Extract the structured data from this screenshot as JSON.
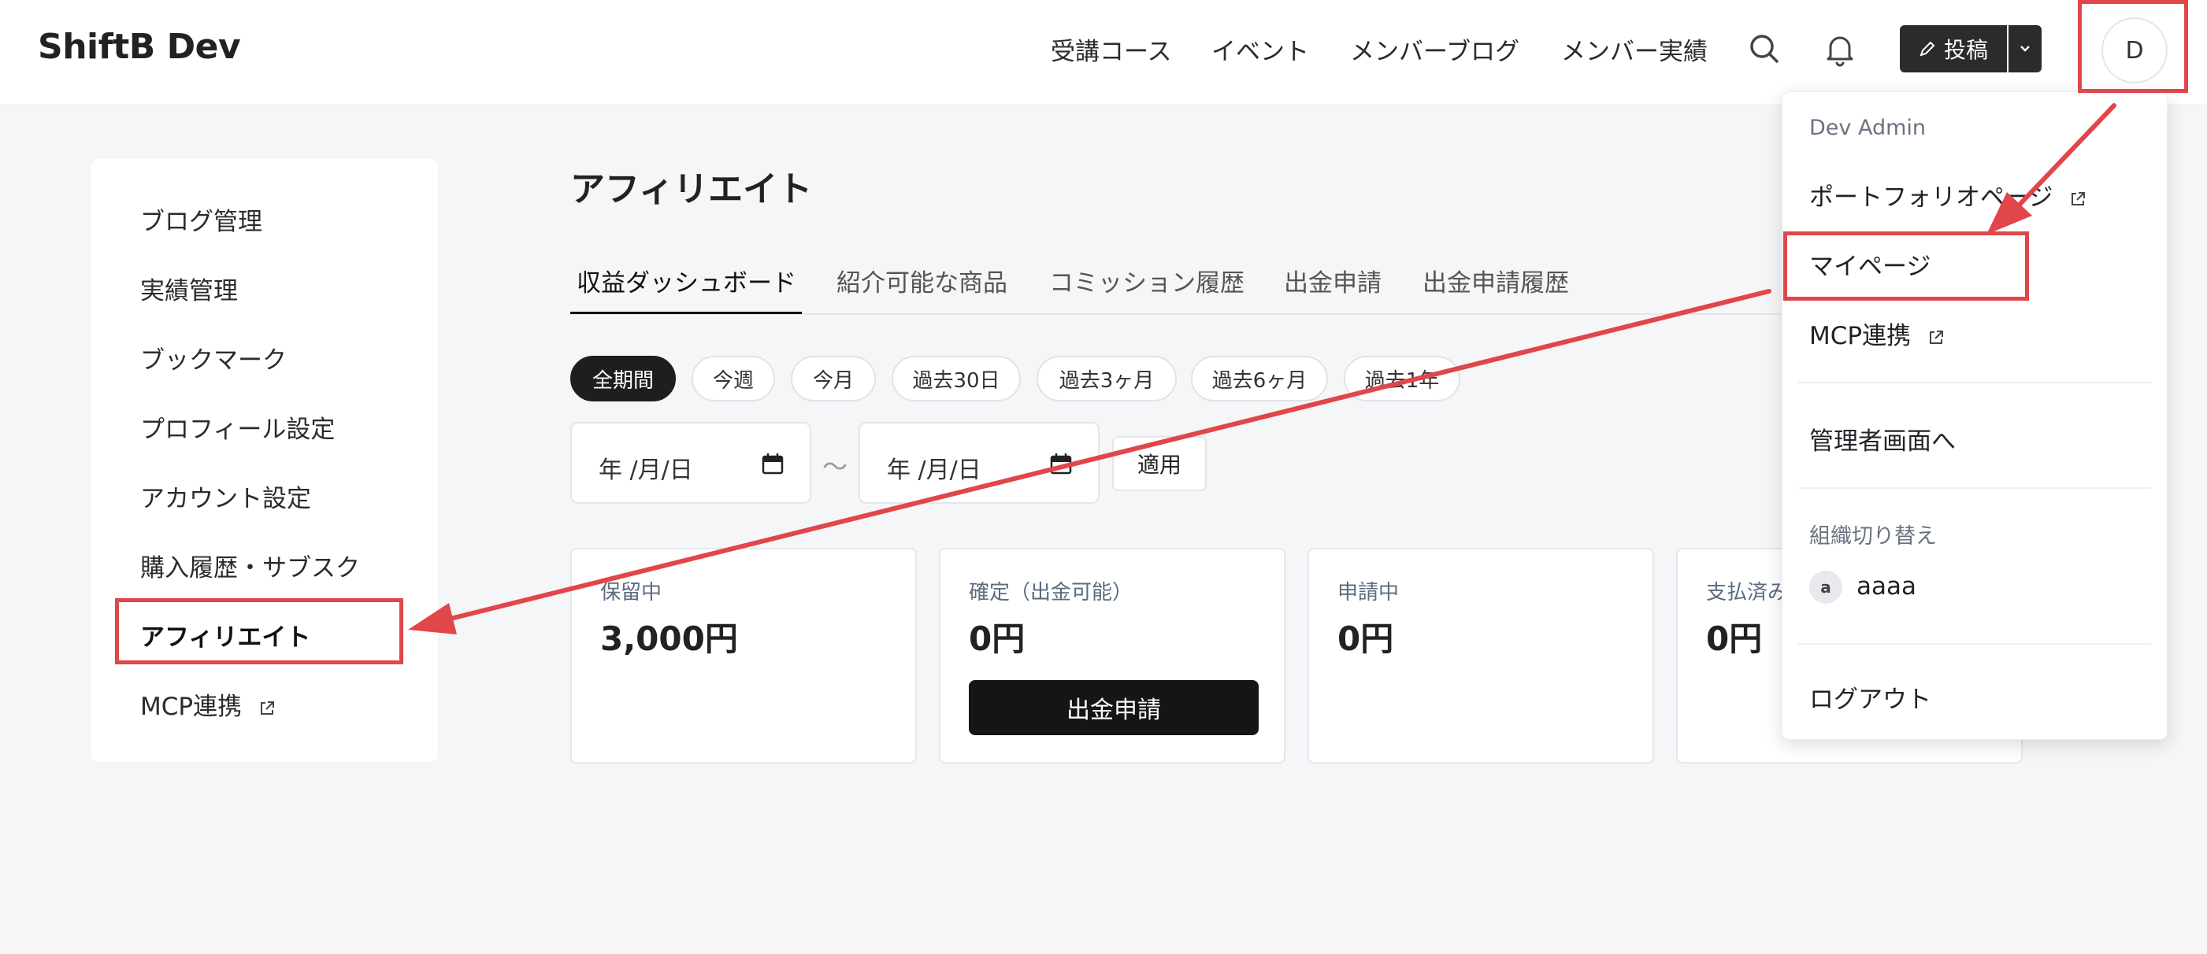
{
  "header": {
    "logo": "ShiftB Dev",
    "nav": [
      "受講コース",
      "イベント",
      "メンバーブログ",
      "メンバー実績"
    ],
    "post_label": "投稿",
    "avatar_initial": "D",
    "icons": [
      "search-icon",
      "bell-icon",
      "pencil-icon",
      "chevron-down-icon"
    ]
  },
  "sidebar": {
    "items": [
      {
        "label": "ブログ管理"
      },
      {
        "label": "実績管理"
      },
      {
        "label": "ブックマーク"
      },
      {
        "label": "プロフィール設定"
      },
      {
        "label": "アカウント設定"
      },
      {
        "label": "購入履歴・サブスク"
      },
      {
        "label": "アフィリエイト",
        "active": true
      },
      {
        "label": "MCP連携",
        "external": true
      }
    ]
  },
  "main": {
    "title": "アフィリエイト",
    "tabs": [
      "収益ダッシュボード",
      "紹介可能な商品",
      "コミッション履歴",
      "出金申請",
      "出金申請履歴"
    ],
    "active_tab": "収益ダッシュボード",
    "periods": [
      "全期間",
      "今週",
      "今月",
      "過去30日",
      "過去3ヶ月",
      "過去6ヶ月",
      "過去1年"
    ],
    "active_period": "全期間",
    "date_from": "年 /月/日",
    "date_separator": "〜",
    "date_to": "年 /月/日",
    "apply_label": "適用",
    "cards": [
      {
        "label": "保留中",
        "value": "3,000円"
      },
      {
        "label": "確定（出金可能）",
        "value": "0円",
        "button": "出金申請"
      },
      {
        "label": "申請中",
        "value": "0円"
      },
      {
        "label": "支払済み",
        "value": "0円"
      }
    ]
  },
  "user_menu": {
    "user_name": "Dev Admin",
    "items": [
      "ポートフォリオページ",
      "マイページ",
      "MCP連携"
    ],
    "admin_link": "管理者画面へ",
    "org_header": "組織切り替え",
    "org_initial": "a",
    "org_name": "aaaa",
    "logout": "ログアウト"
  },
  "annotations": {
    "color": "#e0464a",
    "highlighted": [
      "avatar-button",
      "menu-item-mypage",
      "sidebar-item-affiliate"
    ]
  }
}
